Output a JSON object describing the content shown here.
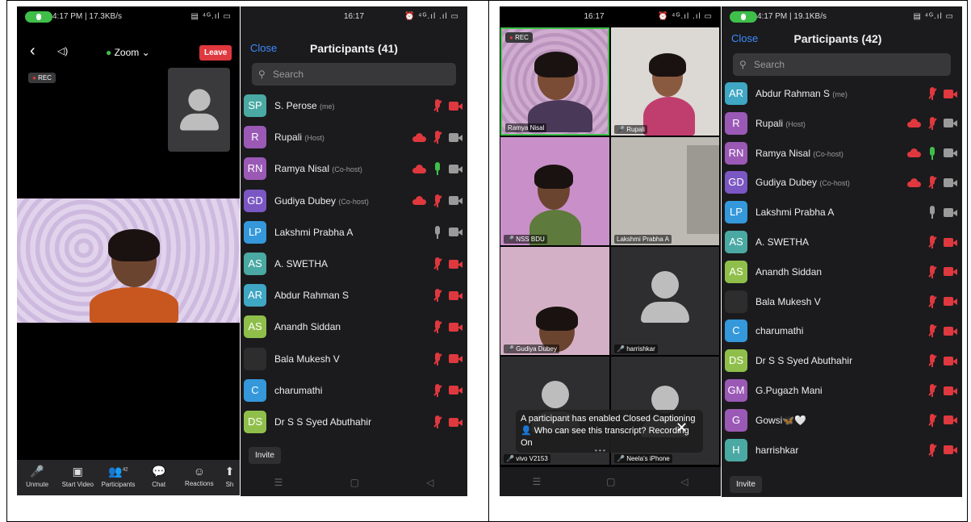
{
  "colors": {
    "accent": "#3d8bff",
    "muted": "#e0383f",
    "active": "#3fbf4a"
  },
  "left_meeting": {
    "status": {
      "time": "4:17 PM | 17.3KB/s",
      "icons": "▤ ⁴ᴳ.ıl ▭"
    },
    "topbar": {
      "zoom_label": "Zoom",
      "leave_label": "Leave"
    },
    "rec_label": "REC",
    "toolbar": [
      {
        "label": "Unmute",
        "icon": "mic-muted-icon"
      },
      {
        "label": "Start Video",
        "icon": "video-off-icon"
      },
      {
        "label": "Participants",
        "icon": "participants-icon",
        "badge": "42"
      },
      {
        "label": "Chat",
        "icon": "chat-icon"
      },
      {
        "label": "Reactions",
        "icon": "reactions-icon"
      },
      {
        "label": "Sh",
        "icon": "share-icon"
      }
    ]
  },
  "left_participants": {
    "status": {
      "time": "16:17",
      "icons": "⏰ ⁴ᴳ.ıl .ıl ▭"
    },
    "close_label": "Close",
    "title": "Participants (41)",
    "search_placeholder": "Search",
    "invite_label": "Invite",
    "rows": [
      {
        "initials": "SP",
        "name": "S. Perose",
        "role": "(me)",
        "color": "#4aa9a3",
        "cloud": false,
        "mic": "muted",
        "cam": "off"
      },
      {
        "initials": "R",
        "name": "Rupali",
        "role": "(Host)",
        "color": "#9b59b6",
        "cloud": true,
        "mic": "muted",
        "cam": "on"
      },
      {
        "initials": "RN",
        "name": "Ramya Nisal",
        "role": "(Co-host)",
        "color": "#9b59b6",
        "cloud": true,
        "mic": "on",
        "cam": "on"
      },
      {
        "initials": "GD",
        "name": "Gudiya Dubey",
        "role": "(Co-host)",
        "color": "#7b57c4",
        "cloud": true,
        "mic": "muted",
        "cam": "on"
      },
      {
        "initials": "LP",
        "name": "Lakshmi Prabha A",
        "role": "",
        "color": "#3498db",
        "cloud": false,
        "mic": "idle",
        "cam": "on"
      },
      {
        "initials": "AS",
        "name": "A. SWETHA",
        "role": "",
        "color": "#4aa9a3",
        "cloud": false,
        "mic": "muted",
        "cam": "off"
      },
      {
        "initials": "AR",
        "name": "Abdur Rahman S",
        "role": "",
        "color": "#3fa6c4",
        "cloud": false,
        "mic": "muted",
        "cam": "off"
      },
      {
        "initials": "AS",
        "name": "Anandh Siddan",
        "role": "",
        "color": "#8fbf4a",
        "cloud": false,
        "mic": "muted",
        "cam": "off"
      },
      {
        "initials": "",
        "name": "Bala Mukesh V",
        "role": "",
        "color": "#2d2d2d",
        "cloud": false,
        "mic": "muted",
        "cam": "off"
      },
      {
        "initials": "C",
        "name": "charumathi",
        "role": "",
        "color": "#3498db",
        "cloud": false,
        "mic": "muted",
        "cam": "off"
      },
      {
        "initials": "DS",
        "name": "Dr S S Syed Abuthahir",
        "role": "",
        "color": "#8fbf4a",
        "cloud": false,
        "mic": "muted",
        "cam": "off"
      }
    ]
  },
  "right_gallery": {
    "status": {
      "time": "16:17",
      "icons": "⏰ ⁴ᴳ.ıl .ıl ▭"
    },
    "rec_label": "REC",
    "tiles": [
      {
        "label": "Ramya Nisal"
      },
      {
        "label": "Rupali"
      },
      {
        "label": "NSS BDU"
      },
      {
        "label": "Lakshmi Prabha A"
      },
      {
        "label": "Gudiya Dubey"
      },
      {
        "label": "harrishkar"
      },
      {
        "label": "vivo V2153"
      },
      {
        "label": "Neela's iPhone"
      }
    ],
    "caption_line1": "A participant has enabled Closed Captioning",
    "caption_line2": "Who can see this transcript? Recording On"
  },
  "right_participants": {
    "status": {
      "time": "4:17 PM | 19.1KB/s",
      "icons": "▤ ⁴ᴳ.ıl ▭"
    },
    "close_label": "Close",
    "title": "Participants (42)",
    "search_placeholder": "Search",
    "invite_label": "Invite",
    "rows": [
      {
        "initials": "AR",
        "name": "Abdur Rahman S",
        "role": "(me)",
        "color": "#3fa6c4",
        "cloud": false,
        "mic": "muted",
        "cam": "off"
      },
      {
        "initials": "R",
        "name": "Rupali",
        "role": "(Host)",
        "color": "#9b59b6",
        "cloud": true,
        "mic": "muted",
        "cam": "on"
      },
      {
        "initials": "RN",
        "name": "Ramya Nisal",
        "role": "(Co-host)",
        "color": "#9b59b6",
        "cloud": true,
        "mic": "on",
        "cam": "on"
      },
      {
        "initials": "GD",
        "name": "Gudiya Dubey",
        "role": "(Co-host)",
        "color": "#7b57c4",
        "cloud": true,
        "mic": "muted",
        "cam": "on"
      },
      {
        "initials": "LP",
        "name": "Lakshmi Prabha A",
        "role": "",
        "color": "#3498db",
        "cloud": false,
        "mic": "idle",
        "cam": "on"
      },
      {
        "initials": "AS",
        "name": "A. SWETHA",
        "role": "",
        "color": "#4aa9a3",
        "cloud": false,
        "mic": "muted",
        "cam": "off"
      },
      {
        "initials": "AS",
        "name": "Anandh Siddan",
        "role": "",
        "color": "#8fbf4a",
        "cloud": false,
        "mic": "muted",
        "cam": "off"
      },
      {
        "initials": "",
        "name": "Bala Mukesh V",
        "role": "",
        "color": "#2d2d2d",
        "cloud": false,
        "mic": "muted",
        "cam": "off"
      },
      {
        "initials": "C",
        "name": "charumathi",
        "role": "",
        "color": "#3498db",
        "cloud": false,
        "mic": "muted",
        "cam": "off"
      },
      {
        "initials": "DS",
        "name": "Dr S S Syed Abuthahir",
        "role": "",
        "color": "#8fbf4a",
        "cloud": false,
        "mic": "muted",
        "cam": "off"
      },
      {
        "initials": "GM",
        "name": "G.Pugazh Mani",
        "role": "",
        "color": "#9b59b6",
        "cloud": false,
        "mic": "muted",
        "cam": "off"
      },
      {
        "initials": "G",
        "name": "Gowsi🦋🤍",
        "role": "",
        "color": "#9b59b6",
        "cloud": false,
        "mic": "muted",
        "cam": "off"
      },
      {
        "initials": "H",
        "name": "harrishkar",
        "role": "",
        "color": "#4aa9a3",
        "cloud": false,
        "mic": "muted",
        "cam": "off"
      }
    ]
  }
}
